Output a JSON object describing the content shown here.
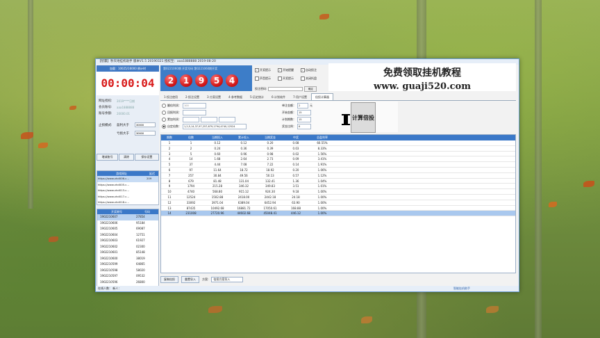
{
  "window": {
    "title": "【智赢】秒天地挂机助手  版本V1.5  20190321    授权至：aaa1888888  2019-08-20"
  },
  "left_panel": {
    "timer_header": "加载：10025/16000  倒计时",
    "timer": "00:00:04",
    "info": [
      {
        "label": "网址授权:",
        "value": "2019****日期"
      },
      {
        "label": "会员账号:",
        "value": "aaa1888888"
      },
      {
        "label": "账号余额:",
        "value": "20000.01"
      }
    ],
    "stop_label": "止损模式:",
    "win_label": "盈利大于",
    "win_value": "30000",
    "loss_label": "亏损大于",
    "loss_value": "30000",
    "buttons": [
      "增减账号",
      "清除",
      "保存设置"
    ],
    "url_header": [
      "游戏网址",
      "延迟"
    ],
    "urls": [
      {
        "url": "https://www.vhd006.c...",
        "delay": "209",
        "selected": true
      },
      {
        "url": "https://www.vhd005.c...",
        "delay": "",
        "selected": false
      },
      {
        "url": "https://www.vhd013.c...",
        "delay": "",
        "selected": false
      },
      {
        "url": "https://www.vhd017.c...",
        "delay": "",
        "selected": false
      },
      {
        "url": "https://www.vhd018.c...",
        "delay": "",
        "selected": false
      }
    ],
    "acc_header": [
      "开奖期号",
      "号码"
    ],
    "accounts": [
      {
        "issue": "1902210607",
        "num": "27854",
        "selected": true
      },
      {
        "issue": "1902210606",
        "num": "95184",
        "selected": false
      },
      {
        "issue": "1902210605",
        "num": "69087",
        "selected": false
      },
      {
        "issue": "1902210604",
        "num": "12751",
        "selected": false
      },
      {
        "issue": "1902210603",
        "num": "61927",
        "selected": false
      },
      {
        "issue": "1902210602",
        "num": "02300",
        "selected": false
      },
      {
        "issue": "1902210601",
        "num": "85148",
        "selected": false
      },
      {
        "issue": "1902210600",
        "num": "38019",
        "selected": false
      },
      {
        "issue": "1902210599",
        "num": "64865",
        "selected": false
      },
      {
        "issue": "1902210598",
        "num": "58020",
        "selected": false
      },
      {
        "issue": "1902210597",
        "num": "09532",
        "selected": false
      },
      {
        "issue": "1902210596",
        "num": "26800",
        "selected": false
      }
    ]
  },
  "draw": {
    "caption": "第0221060期  开奖号码   第0221060期开奖",
    "balls": [
      "2",
      "1",
      "9",
      "5",
      "4"
    ]
  },
  "checks": {
    "items": [
      {
        "label": "开奖提示",
        "on": true
      },
      {
        "label": "开始提醒",
        "on": true
      },
      {
        "label": "自动投注",
        "on": true
      },
      {
        "label": "声音提示",
        "on": false
      },
      {
        "label": "开奖提示",
        "on": false
      },
      {
        "label": "关闭托盘",
        "on": false
      }
    ],
    "input_label": "投注密码:",
    "input_button": "确定"
  },
  "ad": {
    "line1": "免费领取挂机教程",
    "line2": "www. guaji520.com"
  },
  "tabs": [
    "1-投注使用",
    "2-投注设置",
    "3-方案设置",
    "4-参考数据",
    "5-历史统计",
    "6-计划软件",
    "7-用户设置",
    "倍投计算器"
  ],
  "active_tab": 7,
  "form": {
    "r1_label": "翻倍利润：",
    "r1_val": "100",
    "r2_label": "回报利润：",
    "r2_val": "",
    "r3_label": "累加利润：",
    "r3_a": "",
    "r3_b": "",
    "r3_c": "",
    "r4_label": "自定倍数：",
    "r4_val": "1,2,5,14,37,97,257,679,1794,4740,12524",
    "f1_label": "单注金额：",
    "f1_val": "2",
    "f1_unit": "元",
    "f2_label": "开始金额：",
    "f2_val": "15",
    "f3_label": "计划期数：",
    "f3_val": "15",
    "f4_label": "奖金比例：",
    "f4_val": "6",
    "calc_button": "计算倍投"
  },
  "grid": {
    "headers": [
      "期数",
      "倍数",
      "当期投入",
      "累计投入",
      "当期奖金",
      "中奖",
      "总盈利率"
    ],
    "rows": [
      [
        "1",
        "1",
        "0.12",
        "0.12",
        "0.20",
        "0.08",
        "66.55%"
      ],
      [
        "2",
        "2",
        "0.24",
        "0.36",
        "0.39",
        "0.03",
        "8.33%"
      ],
      [
        "3",
        "5",
        "0.60",
        "0.96",
        "0.98",
        "0.02",
        "1.56%"
      ],
      [
        "4",
        "14",
        "1.68",
        "2.64",
        "2.73",
        "0.09",
        "3.41%"
      ],
      [
        "5",
        "37",
        "4.44",
        "7.08",
        "7.22",
        "0.14",
        "1.91%"
      ],
      [
        "6",
        "97",
        "11.64",
        "18.72",
        "18.92",
        "0.20",
        "1.06%"
      ],
      [
        "7",
        "257",
        "30.84",
        "49.56",
        "50.13",
        "0.57",
        "1.12%"
      ],
      [
        "8",
        "679",
        "81.48",
        "131.04",
        "132.41",
        "1.36",
        "1.04%"
      ],
      [
        "9",
        "1794",
        "215.28",
        "346.32",
        "349.83",
        "3.51",
        "1.01%"
      ],
      [
        "10",
        "4740",
        "568.80",
        "915.12",
        "924.30",
        "9.18",
        "1.00%"
      ],
      [
        "11",
        "12524",
        "1502.88",
        "2418.00",
        "2442.18",
        "24.18",
        "1.00%"
      ],
      [
        "12",
        "33092",
        "3971.04",
        "6389.04",
        "6452.94",
        "63.90",
        "1.00%"
      ],
      [
        "13",
        "87435",
        "10492.68",
        "16881.72",
        "17050.61",
        "168.88",
        "1.00%"
      ],
      [
        "14",
        "231008",
        "27720.96",
        "44602.68",
        "45048.41",
        "446.12",
        "1.00%"
      ]
    ],
    "selected_row": 13
  },
  "bottom": {
    "b1": "复制倍投",
    "b2": "重置导入",
    "lbl": "方案:",
    "sel": "倍投方案导入",
    "bar": ""
  },
  "status": {
    "left": "在线人数：   新人：",
    "right": "智能挂机助手"
  }
}
